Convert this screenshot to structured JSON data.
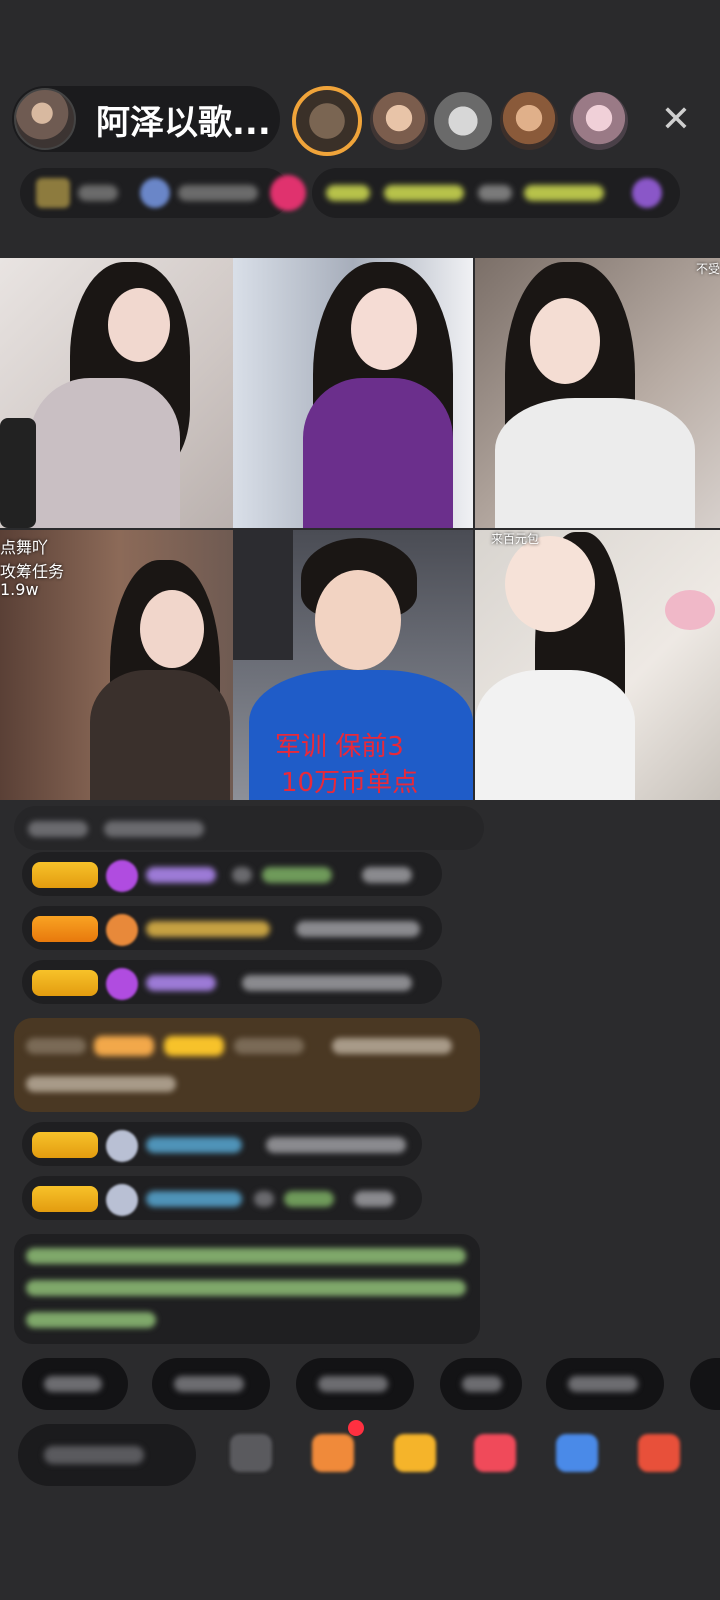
{
  "header": {
    "host_name": "阿泽以歌...",
    "close_icon": "close-icon"
  },
  "video_grid": {
    "tiles": [
      {
        "id": "tile-1"
      },
      {
        "id": "tile-2"
      },
      {
        "id": "tile-3",
        "corner_label": "不受"
      },
      {
        "id": "tile-4",
        "labels": [
          "点舞吖",
          "攻筹任务",
          "1.9w"
        ]
      },
      {
        "id": "tile-5",
        "overlay_lines": [
          "军训 保前3",
          "10万币单点"
        ]
      },
      {
        "id": "tile-6",
        "corner_label": "来百元包"
      }
    ]
  },
  "colors": {
    "background": "#2b2b2d",
    "level_badge": "#f7c22a",
    "overlay_red": "#e8293a",
    "system_msg_bg": "#4a3823"
  }
}
